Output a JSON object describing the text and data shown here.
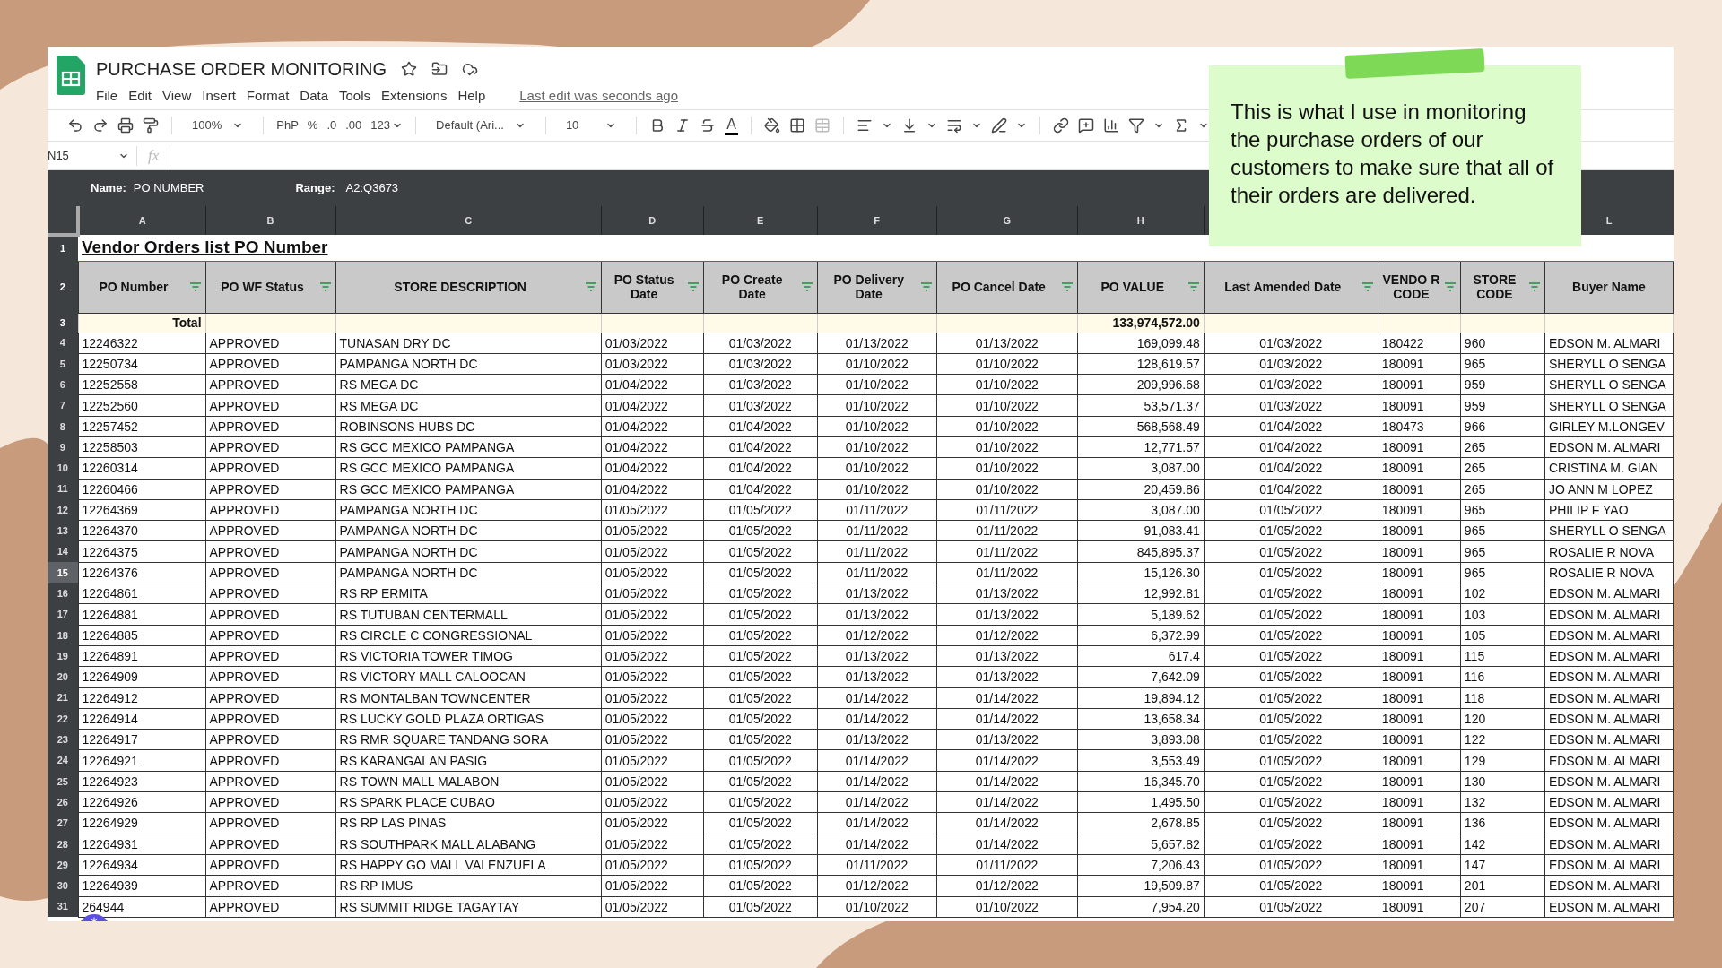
{
  "window": {
    "title": "PURCHASE ORDER MONITORING",
    "menu": [
      "File",
      "Edit",
      "View",
      "Insert",
      "Format",
      "Data",
      "Tools",
      "Extensions",
      "Help"
    ],
    "last_edit": "Last edit was seconds ago"
  },
  "toolbar": {
    "zoom": "100%",
    "currency": "PhP",
    "percent": "%",
    "decrease_decimal": ".0",
    "increase_decimal": ".00",
    "number_format": "123",
    "font": "Default (Ari...",
    "font_size": "10",
    "text_color": "A"
  },
  "formula_bar": {
    "cell": "N15",
    "fx": "fx"
  },
  "named_range": {
    "name_label": "Name:",
    "name": "PO NUMBER",
    "range_label": "Range:",
    "range": "A2:Q3673"
  },
  "column_letters": [
    "A",
    "B",
    "C",
    "D",
    "E",
    "F",
    "G",
    "H"
  ],
  "column_letters_right": [
    "L"
  ],
  "sheet_title": "Vendor Orders list PO Number",
  "headers": [
    {
      "label": "PO Number",
      "filter": true
    },
    {
      "label": "PO WF Status",
      "filter": true
    },
    {
      "label": "STORE DESCRIPTION",
      "filter": true
    },
    {
      "label": "PO Status Date",
      "filter": true
    },
    {
      "label": "PO Create Date",
      "filter": true
    },
    {
      "label": "PO Delivery Date",
      "filter": true
    },
    {
      "label": "PO Cancel Date",
      "filter": true
    },
    {
      "label": "PO VALUE",
      "filter": true
    },
    {
      "label": "Last Amended Date",
      "filter": true
    },
    {
      "label": "VENDO R CODE",
      "filter": true
    },
    {
      "label": "STORE CODE",
      "filter": true
    },
    {
      "label": "Buyer Name",
      "filter": false
    }
  ],
  "header_row_num": "2",
  "title_row_num": "1",
  "total_row_num": "3",
  "total": {
    "label": "Total",
    "value": "133,974,572.00"
  },
  "rows": [
    {
      "num": "4",
      "selected": false,
      "cells": [
        "12246322",
        "APPROVED",
        "TUNASAN DRY DC",
        "01/03/2022",
        "01/03/2022",
        "01/13/2022",
        "01/13/2022",
        "169,099.48",
        "01/03/2022",
        "180422",
        "960",
        "EDSON M. ALMARI"
      ]
    },
    {
      "num": "5",
      "selected": false,
      "cells": [
        "12250734",
        "APPROVED",
        "PAMPANGA NORTH DC",
        "01/03/2022",
        "01/03/2022",
        "01/10/2022",
        "01/10/2022",
        "128,619.57",
        "01/03/2022",
        "180091",
        "965",
        "SHERYLL O SENGA"
      ]
    },
    {
      "num": "6",
      "selected": false,
      "cells": [
        "12252558",
        "APPROVED",
        "RS MEGA DC",
        "01/04/2022",
        "01/03/2022",
        "01/10/2022",
        "01/10/2022",
        "209,996.68",
        "01/03/2022",
        "180091",
        "959",
        "SHERYLL O SENGA"
      ]
    },
    {
      "num": "7",
      "selected": false,
      "cells": [
        "12252560",
        "APPROVED",
        "RS MEGA DC",
        "01/04/2022",
        "01/03/2022",
        "01/10/2022",
        "01/10/2022",
        "53,571.37",
        "01/03/2022",
        "180091",
        "959",
        "SHERYLL O SENGA"
      ]
    },
    {
      "num": "8",
      "selected": false,
      "cells": [
        "12257452",
        "APPROVED",
        "ROBINSONS HUBS DC",
        "01/04/2022",
        "01/04/2022",
        "01/10/2022",
        "01/10/2022",
        "568,568.49",
        "01/04/2022",
        "180473",
        "966",
        "GIRLEY M.LONGEV"
      ]
    },
    {
      "num": "9",
      "selected": false,
      "cells": [
        "12258503",
        "APPROVED",
        "RS GCC MEXICO PAMPANGA",
        "01/04/2022",
        "01/04/2022",
        "01/10/2022",
        "01/10/2022",
        "12,771.57",
        "01/04/2022",
        "180091",
        "265",
        "EDSON M. ALMARI"
      ]
    },
    {
      "num": "10",
      "selected": false,
      "cells": [
        "12260314",
        "APPROVED",
        "RS GCC MEXICO PAMPANGA",
        "01/04/2022",
        "01/04/2022",
        "01/10/2022",
        "01/10/2022",
        "3,087.00",
        "01/04/2022",
        "180091",
        "265",
        "CRISTINA M. GIAN"
      ]
    },
    {
      "num": "11",
      "selected": false,
      "cells": [
        "12260466",
        "APPROVED",
        "RS GCC MEXICO PAMPANGA",
        "01/04/2022",
        "01/04/2022",
        "01/10/2022",
        "01/10/2022",
        "20,459.86",
        "01/04/2022",
        "180091",
        "265",
        "JO ANN M LOPEZ"
      ]
    },
    {
      "num": "12",
      "selected": false,
      "cells": [
        "12264369",
        "APPROVED",
        "PAMPANGA NORTH DC",
        "01/05/2022",
        "01/05/2022",
        "01/11/2022",
        "01/11/2022",
        "3,087.00",
        "01/05/2022",
        "180091",
        "965",
        "PHILIP F YAO"
      ]
    },
    {
      "num": "13",
      "selected": false,
      "cells": [
        "12264370",
        "APPROVED",
        "PAMPANGA NORTH DC",
        "01/05/2022",
        "01/05/2022",
        "01/11/2022",
        "01/11/2022",
        "91,083.41",
        "01/05/2022",
        "180091",
        "965",
        "SHERYLL O SENGA"
      ]
    },
    {
      "num": "14",
      "selected": false,
      "cells": [
        "12264375",
        "APPROVED",
        "PAMPANGA NORTH DC",
        "01/05/2022",
        "01/05/2022",
        "01/11/2022",
        "01/11/2022",
        "845,895.37",
        "01/05/2022",
        "180091",
        "965",
        "ROSALIE R NOVA"
      ]
    },
    {
      "num": "15",
      "selected": true,
      "cells": [
        "12264376",
        "APPROVED",
        "PAMPANGA NORTH DC",
        "01/05/2022",
        "01/05/2022",
        "01/11/2022",
        "01/11/2022",
        "15,126.30",
        "01/05/2022",
        "180091",
        "965",
        "ROSALIE R NOVA"
      ]
    },
    {
      "num": "16",
      "selected": false,
      "cells": [
        "12264861",
        "APPROVED",
        "RS RP ERMITA",
        "01/05/2022",
        "01/05/2022",
        "01/13/2022",
        "01/13/2022",
        "12,992.81",
        "01/05/2022",
        "180091",
        "102",
        "EDSON M. ALMARI"
      ]
    },
    {
      "num": "17",
      "selected": false,
      "cells": [
        "12264881",
        "APPROVED",
        "RS TUTUBAN CENTERMALL",
        "01/05/2022",
        "01/05/2022",
        "01/13/2022",
        "01/13/2022",
        "5,189.62",
        "01/05/2022",
        "180091",
        "103",
        "EDSON M. ALMARI"
      ]
    },
    {
      "num": "18",
      "selected": false,
      "cells": [
        "12264885",
        "APPROVED",
        "RS CIRCLE C CONGRESSIONAL",
        "01/05/2022",
        "01/05/2022",
        "01/12/2022",
        "01/12/2022",
        "6,372.99",
        "01/05/2022",
        "180091",
        "105",
        "EDSON M. ALMARI"
      ]
    },
    {
      "num": "19",
      "selected": false,
      "cells": [
        "12264891",
        "APPROVED",
        "RS VICTORIA TOWER TIMOG",
        "01/05/2022",
        "01/05/2022",
        "01/13/2022",
        "01/13/2022",
        "617.4",
        "01/05/2022",
        "180091",
        "115",
        "EDSON M. ALMARI"
      ]
    },
    {
      "num": "20",
      "selected": false,
      "cells": [
        "12264909",
        "APPROVED",
        "RS VICTORY MALL CALOOCAN",
        "01/05/2022",
        "01/05/2022",
        "01/13/2022",
        "01/13/2022",
        "7,642.09",
        "01/05/2022",
        "180091",
        "116",
        "EDSON M. ALMARI"
      ]
    },
    {
      "num": "21",
      "selected": false,
      "cells": [
        "12264912",
        "APPROVED",
        "RS MONTALBAN TOWNCENTER",
        "01/05/2022",
        "01/05/2022",
        "01/14/2022",
        "01/14/2022",
        "19,894.12",
        "01/05/2022",
        "180091",
        "118",
        "EDSON M. ALMARI"
      ]
    },
    {
      "num": "22",
      "selected": false,
      "cells": [
        "12264914",
        "APPROVED",
        "RS LUCKY GOLD PLAZA ORTIGAS",
        "01/05/2022",
        "01/05/2022",
        "01/14/2022",
        "01/14/2022",
        "13,658.34",
        "01/05/2022",
        "180091",
        "120",
        "EDSON M. ALMARI"
      ]
    },
    {
      "num": "23",
      "selected": false,
      "cells": [
        "12264917",
        "APPROVED",
        "RS RMR SQUARE TANDANG SORA",
        "01/05/2022",
        "01/05/2022",
        "01/13/2022",
        "01/13/2022",
        "3,893.08",
        "01/05/2022",
        "180091",
        "122",
        "EDSON M. ALMARI"
      ]
    },
    {
      "num": "24",
      "selected": false,
      "cells": [
        "12264921",
        "APPROVED",
        "RS KARANGALAN PASIG",
        "01/05/2022",
        "01/05/2022",
        "01/14/2022",
        "01/14/2022",
        "3,553.49",
        "01/05/2022",
        "180091",
        "129",
        "EDSON M. ALMARI"
      ]
    },
    {
      "num": "25",
      "selected": false,
      "cells": [
        "12264923",
        "APPROVED",
        "RS TOWN MALL MALABON",
        "01/05/2022",
        "01/05/2022",
        "01/14/2022",
        "01/14/2022",
        "16,345.70",
        "01/05/2022",
        "180091",
        "130",
        "EDSON M. ALMARI"
      ]
    },
    {
      "num": "26",
      "selected": false,
      "cells": [
        "12264926",
        "APPROVED",
        "RS SPARK PLACE CUBAO",
        "01/05/2022",
        "01/05/2022",
        "01/14/2022",
        "01/14/2022",
        "1,495.50",
        "01/05/2022",
        "180091",
        "132",
        "EDSON M. ALMARI"
      ]
    },
    {
      "num": "27",
      "selected": false,
      "cells": [
        "12264929",
        "APPROVED",
        "RS RP LAS PINAS",
        "01/05/2022",
        "01/05/2022",
        "01/14/2022",
        "01/14/2022",
        "2,678.85",
        "01/05/2022",
        "180091",
        "136",
        "EDSON M. ALMARI"
      ]
    },
    {
      "num": "28",
      "selected": false,
      "cells": [
        "12264931",
        "APPROVED",
        "RS SOUTHPARK MALL ALABANG",
        "01/05/2022",
        "01/05/2022",
        "01/14/2022",
        "01/14/2022",
        "5,657.82",
        "01/05/2022",
        "180091",
        "142",
        "EDSON M. ALMARI"
      ]
    },
    {
      "num": "29",
      "selected": false,
      "cells": [
        "12264934",
        "APPROVED",
        "RS HAPPY GO MALL VALENZUELA",
        "01/05/2022",
        "01/05/2022",
        "01/11/2022",
        "01/11/2022",
        "7,206.43",
        "01/05/2022",
        "180091",
        "147",
        "EDSON M. ALMARI"
      ]
    },
    {
      "num": "30",
      "selected": false,
      "cells": [
        "12264939",
        "APPROVED",
        "RS RP IMUS",
        "01/05/2022",
        "01/05/2022",
        "01/12/2022",
        "01/12/2022",
        "19,509.87",
        "01/05/2022",
        "180091",
        "201",
        "EDSON M. ALMARI"
      ]
    },
    {
      "num": "31",
      "selected": false,
      "cells": [
        "264944",
        "APPROVED",
        "RS SUMMIT RIDGE TAGAYTAY",
        "01/05/2022",
        "01/05/2022",
        "01/10/2022",
        "01/10/2022",
        "7,954.20",
        "01/05/2022",
        "180091",
        "207",
        "EDSON M. ALMARI"
      ]
    }
  ],
  "note": {
    "text": "This is what I use in monitoring the purchase orders of our customers to make sure that all of their orders are delivered."
  }
}
